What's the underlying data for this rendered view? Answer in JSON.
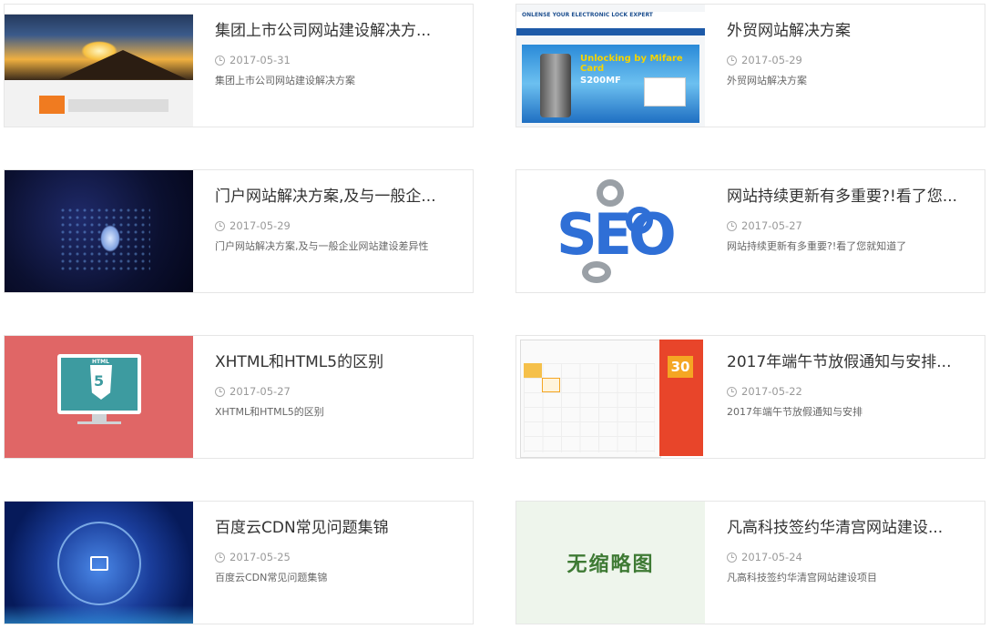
{
  "articles": [
    {
      "title": "集团上市公司网站建设解决方...",
      "date": "2017-05-31",
      "desc": "集团上市公司网站建设解决方案"
    },
    {
      "title": "外贸网站解决方案",
      "date": "2017-05-29",
      "desc": "外贸网站解决方案",
      "thumb_text": "ONLENSE YOUR ELECTRONIC LOCK EXPERT",
      "thumb_banner": "Unlocking by Mifare Card",
      "thumb_model": "S200MF"
    },
    {
      "title": "门户网站解决方案,及与一般企...",
      "date": "2017-05-29",
      "desc": "门户网站解决方案,及与一般企业网站建设差异性"
    },
    {
      "title": "网站持续更新有多重要?!看了您...",
      "date": "2017-05-27",
      "desc": "网站持续更新有多重要?!看了您就知道了",
      "thumb_text": "SEO"
    },
    {
      "title": "XHTML和HTML5的区别",
      "date": "2017-05-27",
      "desc": "XHTML和HTML5的区别",
      "thumb_text": "HTML",
      "thumb_num": "5"
    },
    {
      "title": "2017年端午节放假通知与安排...",
      "date": "2017-05-22",
      "desc": "2017年端午节放假通知与安排",
      "thumb_day": "30"
    },
    {
      "title": "百度云CDN常见问题集锦",
      "date": "2017-05-25",
      "desc": "百度云CDN常见问题集锦"
    },
    {
      "title": "凡高科技签约华清宫网站建设...",
      "date": "2017-05-24",
      "desc": "凡高科技签约华清宫网站建设项目",
      "thumb_text": "无缩略图"
    }
  ],
  "icons": {
    "date": "clock-icon"
  }
}
